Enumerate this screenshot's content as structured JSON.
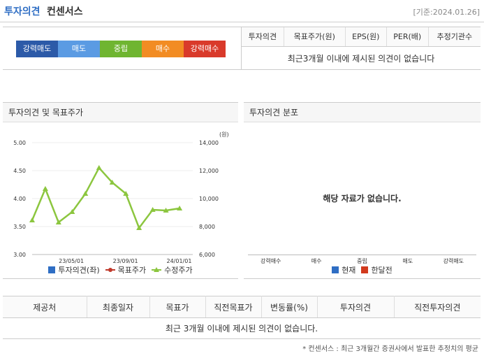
{
  "header": {
    "title": "투자의견",
    "subtitle": "컨센서스",
    "date": "[기준:2024.01.26]"
  },
  "scale": {
    "items": [
      {
        "label": "강력매도",
        "color": "#2c5aa8"
      },
      {
        "label": "매도",
        "color": "#5b9be3"
      },
      {
        "label": "중립",
        "color": "#6fb531"
      },
      {
        "label": "매수",
        "color": "#f28c23"
      },
      {
        "label": "강력매수",
        "color": "#d93a2b"
      }
    ]
  },
  "consensus": {
    "headers": [
      "투자의견",
      "목표주가(원)",
      "EPS(원)",
      "PER(배)",
      "추정기관수"
    ],
    "empty": "최근3개월 이내에 제시된 의견이 없습니다"
  },
  "chart_panel": {
    "title": "투자의견 및 목표주가"
  },
  "dist_panel": {
    "title": "투자의견 분포",
    "empty": "해당 자료가 없습니다.",
    "categories": [
      "강력매수",
      "매수",
      "중립",
      "매도",
      "강력매도"
    ],
    "legend": [
      {
        "label": "현재",
        "color": "#2f6ec4"
      },
      {
        "label": "한달전",
        "color": "#d23a1e"
      }
    ]
  },
  "chart_data": {
    "type": "line",
    "left_axis": {
      "ticks": [
        "5.00",
        "4.50",
        "4.00",
        "3.50",
        "3.00"
      ],
      "range": [
        3,
        5
      ]
    },
    "right_axis": {
      "label": "(원)",
      "ticks": [
        "14,000",
        "12,000",
        "10,000",
        "8,000",
        "6,000"
      ],
      "range": [
        6000,
        14000
      ]
    },
    "x_ticks": [
      "23/05/01",
      "23/09/01",
      "24/01/01"
    ],
    "series": [
      {
        "name": "투자의견(좌)",
        "color": "#2f6ec4",
        "values": []
      },
      {
        "name": "목표주가",
        "color": "#c0392b",
        "values": []
      },
      {
        "name": "수정주가",
        "color": "#8cc63f",
        "values": [
          8450,
          10700,
          8300,
          9050,
          10350,
          12200,
          11150,
          10350,
          7900,
          9200,
          9150,
          9300
        ]
      }
    ],
    "x_range": [
      "2023-02-01",
      "2024-02-01"
    ],
    "x": [
      "2023-02-01",
      "2023-03-03",
      "2023-04-02",
      "2023-05-03",
      "2023-06-02",
      "2023-07-03",
      "2023-08-02",
      "2023-09-02",
      "2023-10-02",
      "2023-11-02",
      "2023-12-02",
      "2024-01-02"
    ]
  },
  "bottom": {
    "headers": [
      "제공처",
      "최종일자",
      "목표가",
      "직전목표가",
      "변동률(%)",
      "투자의견",
      "직전투자의견"
    ],
    "empty": "최근 3개월 이내에 제시된 의견이 없습니다."
  },
  "footnote": "* 컨센서스 : 최근 3개월간 증권사에서 발표한 추정치의 평균"
}
